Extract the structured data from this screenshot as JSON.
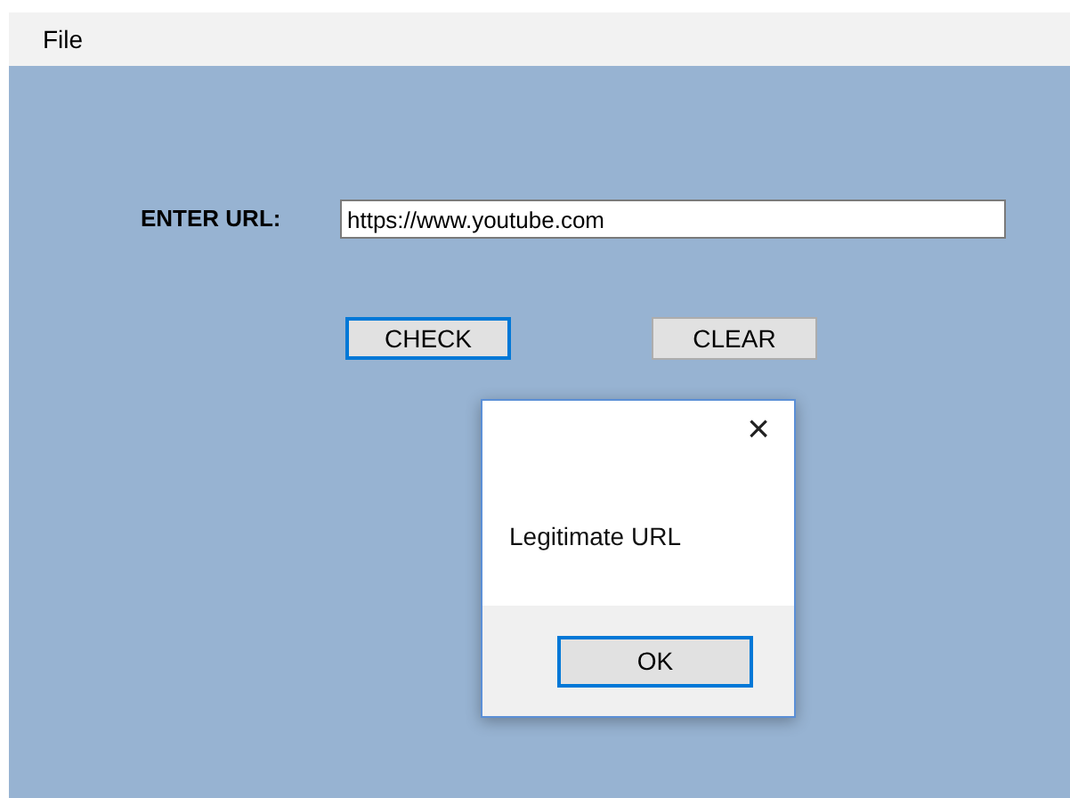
{
  "menu": [
    {
      "label": "File"
    }
  ],
  "form": {
    "label": "ENTER URL:",
    "url": {
      "value": "https://www.youtube.com"
    },
    "buttons": [
      {
        "label": "CHECK",
        "focused": true
      },
      {
        "label": "CLEAR",
        "focused": false
      }
    ]
  },
  "dialog": {
    "close": "×",
    "message": "Legitimate URL",
    "button": {
      "label": "OK",
      "focused": true
    }
  }
}
